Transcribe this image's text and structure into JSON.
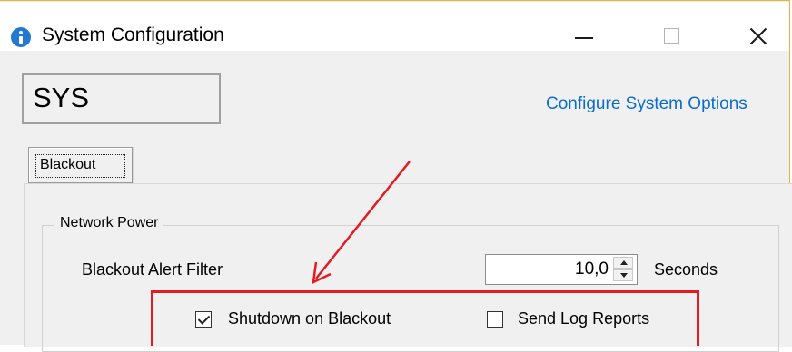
{
  "window": {
    "title": "System Configuration",
    "icon": "info-icon",
    "controls": {
      "minimize": "minimize-icon",
      "maximize": "maximize-icon",
      "close": "close-icon"
    }
  },
  "header": {
    "sys_code": "SYS",
    "config_link": "Configure System Options"
  },
  "tabs": [
    {
      "label": "Blackout",
      "selected": true
    }
  ],
  "group": {
    "title": "Network Power",
    "alert_filter_label": "Blackout Alert Filter",
    "alert_filter_value": "10,0",
    "alert_filter_unit": "Seconds"
  },
  "checkboxes": {
    "shutdown": {
      "label": "Shutdown on Blackout",
      "checked": true
    },
    "send_log": {
      "label": "Send Log Reports",
      "checked": false
    }
  },
  "colors": {
    "accent_link": "#0a6ccf",
    "annotation": "#e41b23",
    "title_icon": "#2379d2"
  }
}
